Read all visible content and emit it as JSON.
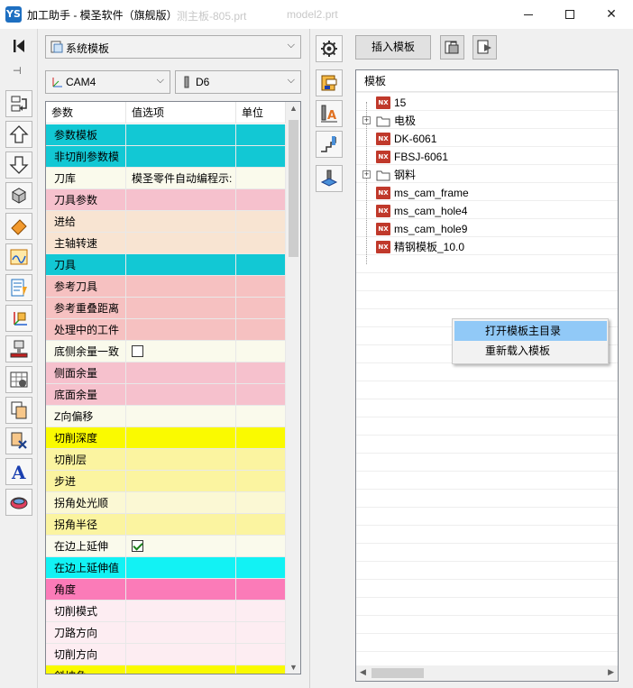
{
  "window": {
    "title": "加工助手 - 模圣软件（旗舰版）",
    "app_icon_text": "YS",
    "background_tabs": [
      "测主板-805.prt",
      "model2.prt"
    ]
  },
  "left_toolbar": {
    "items": [
      "first-icon",
      "pin-icon",
      "swap-icon",
      "move-up-icon",
      "move-down-icon",
      "solid-icon",
      "eraser-icon",
      "path-icon",
      "program-list-icon",
      "axis-icon",
      "machine-icon",
      "tool-grid-icon",
      "copy-icon",
      "delete-icon",
      "text-a-icon",
      "tool-holder-icon"
    ]
  },
  "template_combo": {
    "value": "系统模板"
  },
  "cam_combo": {
    "value": "CAM4"
  },
  "tool_combo": {
    "value": "D6"
  },
  "param_grid": {
    "headers": {
      "param": "参数",
      "value": "值选项",
      "unit": "单位"
    },
    "rows": [
      {
        "label": "参数模板",
        "value": "",
        "unit": "",
        "color": "#12c8d4"
      },
      {
        "label": "非切削参数模",
        "value": "",
        "unit": "",
        "color": "#12c8d4"
      },
      {
        "label": "刀库",
        "value": "模圣零件自动编程示:",
        "unit": "",
        "color": "#fafaec"
      },
      {
        "label": "刀具参数",
        "value": "",
        "unit": "",
        "color": "#f6c1cd"
      },
      {
        "label": "进给",
        "value": "",
        "unit": "",
        "color": "#f8e4d2"
      },
      {
        "label": "主轴转速",
        "value": "",
        "unit": "",
        "color": "#f8e4d2"
      },
      {
        "label": "刀具",
        "value": "",
        "unit": "",
        "color": "#12c8d4"
      },
      {
        "label": "参考刀具",
        "value": "",
        "unit": "",
        "color": "#f6c1c1"
      },
      {
        "label": "参考重叠距离",
        "value": "",
        "unit": "",
        "color": "#f6c1c1"
      },
      {
        "label": "处理中的工件",
        "value": "",
        "unit": "",
        "color": "#f6c1c1"
      },
      {
        "label": "底侧余量一致",
        "checkbox": false,
        "unit": "",
        "color": "#fafaec"
      },
      {
        "label": "侧面余量",
        "value": "",
        "unit": "",
        "color": "#f6c1cd"
      },
      {
        "label": "底面余量",
        "value": "",
        "unit": "",
        "color": "#f6c1cd"
      },
      {
        "label": "Z向偏移",
        "value": "",
        "unit": "",
        "color": "#fafaec"
      },
      {
        "label": "切削深度",
        "value": "",
        "unit": "",
        "color": "#fafa00"
      },
      {
        "label": "切削层",
        "value": "",
        "unit": "",
        "color": "#fbf4a0"
      },
      {
        "label": "步进",
        "value": "",
        "unit": "",
        "color": "#fbf4a0"
      },
      {
        "label": "拐角处光顺",
        "value": "",
        "unit": "",
        "color": "#fbf8d4"
      },
      {
        "label": "拐角半径",
        "value": "",
        "unit": "",
        "color": "#fbf4a0"
      },
      {
        "label": "在边上延伸",
        "checkbox": true,
        "unit": "",
        "color": "#fafaec"
      },
      {
        "label": "在边上延伸值",
        "value": "",
        "unit": "",
        "color": "#12f2f4"
      },
      {
        "label": "角度",
        "value": "",
        "unit": "",
        "color": "#fb7bb8"
      },
      {
        "label": "切削模式",
        "value": "",
        "unit": "",
        "color": "#fdedf2"
      },
      {
        "label": "刀路方向",
        "value": "",
        "unit": "",
        "color": "#fdedf2"
      },
      {
        "label": "切削方向",
        "value": "",
        "unit": "",
        "color": "#fdedf2"
      },
      {
        "label": "斜坡角",
        "value": "",
        "unit": "",
        "color": "#fafa00"
      }
    ]
  },
  "right_toolbar": {
    "items": [
      "settings-gear-icon",
      "template-orange-icon",
      "tool-a-icon",
      "steps-icon",
      "probe-icon"
    ],
    "insert_button_label": "插入模板",
    "extra_buttons": [
      "template-lock-icon",
      "template-export-icon"
    ]
  },
  "template_tree": {
    "header": "模板",
    "items": [
      {
        "label": "15",
        "kind": "nx",
        "expandable": false
      },
      {
        "label": "电极",
        "kind": "folder",
        "expandable": true
      },
      {
        "label": "DK-6061",
        "kind": "nx",
        "expandable": false
      },
      {
        "label": "FBSJ-6061",
        "kind": "nx",
        "expandable": false
      },
      {
        "label": "钢料",
        "kind": "folder",
        "expandable": true
      },
      {
        "label": "ms_cam_frame",
        "kind": "nx",
        "expandable": false
      },
      {
        "label": "ms_cam_hole4",
        "kind": "nx",
        "expandable": false
      },
      {
        "label": "ms_cam_hole9",
        "kind": "nx",
        "expandable": false
      },
      {
        "label": "精钢模板_10.0",
        "kind": "nx",
        "expandable": false
      }
    ],
    "nx_badge_text": "NX"
  },
  "context_menu": {
    "items": [
      {
        "label": "打开模板主目录",
        "highlighted": true
      },
      {
        "label": "重新载入模板",
        "highlighted": false
      }
    ]
  }
}
